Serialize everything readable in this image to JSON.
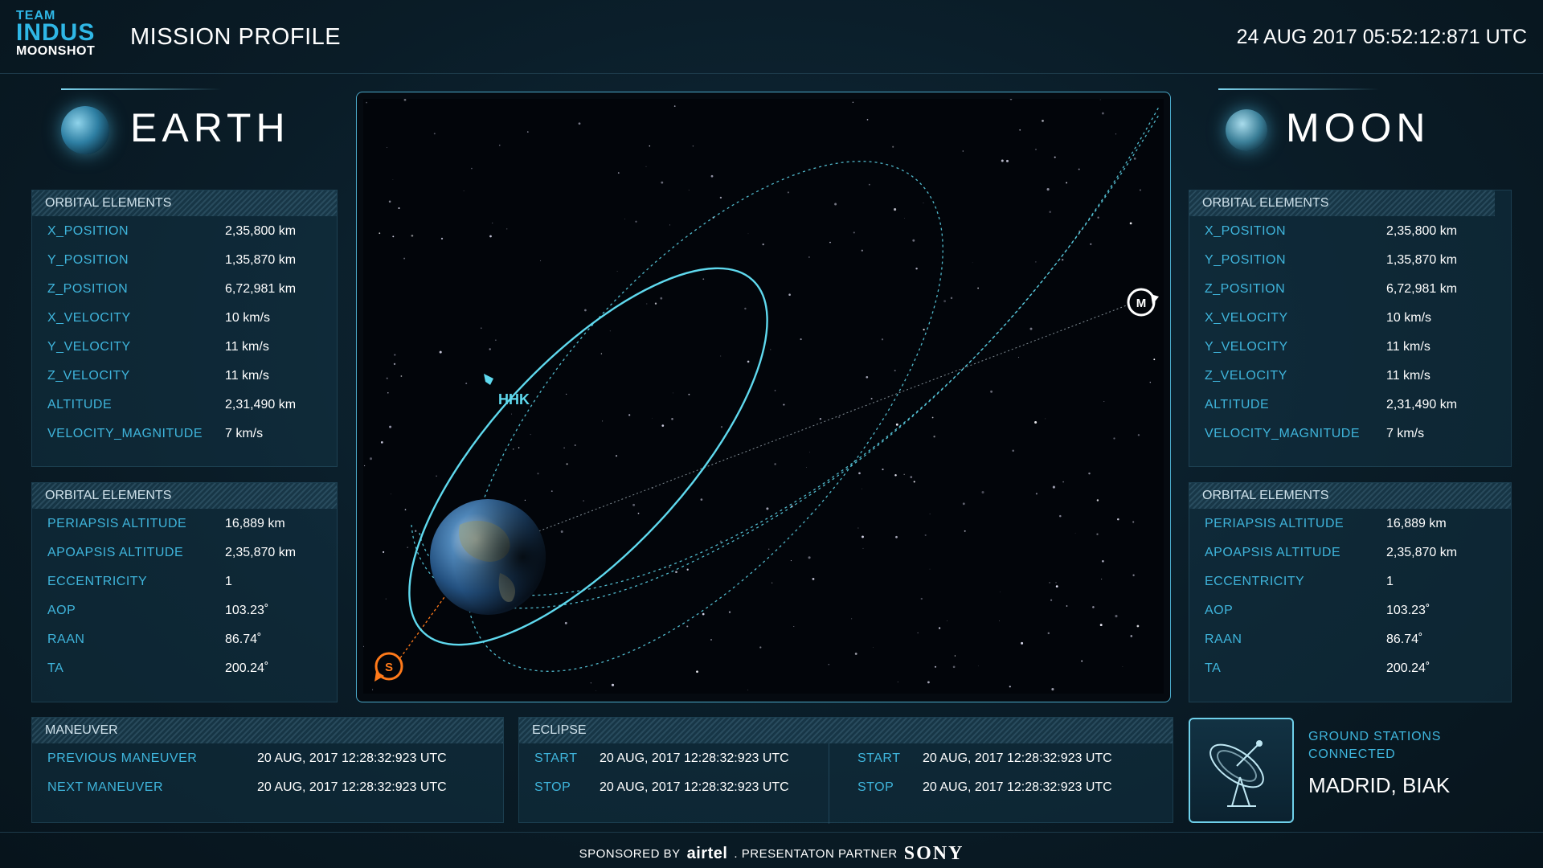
{
  "header": {
    "logo": {
      "line1": "TEAM",
      "line2": "INDUS",
      "line3": "MOONSHOT"
    },
    "title": "MISSION PROFILE",
    "timestamp": "24 AUG 2017 05:52:12:871 UTC"
  },
  "earth": {
    "name": "EARTH",
    "orbital_elements_1": {
      "title": "ORBITAL ELEMENTS",
      "rows": [
        {
          "label": "X_POSITION",
          "value": "2,35,800 km"
        },
        {
          "label": "Y_POSITION",
          "value": "1,35,870 km"
        },
        {
          "label": "Z_POSITION",
          "value": "6,72,981 km"
        },
        {
          "label": "X_VELOCITY",
          "value": "10 km/s"
        },
        {
          "label": "Y_VELOCITY",
          "value": "11 km/s"
        },
        {
          "label": "Z_VELOCITY",
          "value": "11 km/s"
        },
        {
          "label": "ALTITUDE",
          "value": "2,31,490 km"
        },
        {
          "label": "VELOCITY_MAGNITUDE",
          "value": "7 km/s"
        }
      ]
    },
    "orbital_elements_2": {
      "title": "ORBITAL ELEMENTS",
      "rows": [
        {
          "label": "PERIAPSIS ALTITUDE",
          "value": "16,889 km"
        },
        {
          "label": "APOAPSIS ALTITUDE",
          "value": "2,35,870 km"
        },
        {
          "label": "ECCENTRICITY",
          "value": "1"
        },
        {
          "label": "AOP",
          "value": "103.23˚"
        },
        {
          "label": "RAAN",
          "value": "86.74˚"
        },
        {
          "label": "TA",
          "value": "200.24˚"
        }
      ]
    }
  },
  "moon": {
    "name": "MOON",
    "orbital_elements_1": {
      "title": "ORBITAL ELEMENTS",
      "rows": [
        {
          "label": "X_POSITION",
          "value": "2,35,800 km"
        },
        {
          "label": "Y_POSITION",
          "value": "1,35,870 km"
        },
        {
          "label": "Z_POSITION",
          "value": "6,72,981 km"
        },
        {
          "label": "X_VELOCITY",
          "value": "10 km/s"
        },
        {
          "label": "Y_VELOCITY",
          "value": "11 km/s"
        },
        {
          "label": "Z_VELOCITY",
          "value": "11 km/s"
        },
        {
          "label": "ALTITUDE",
          "value": "2,31,490 km"
        },
        {
          "label": "VELOCITY_MAGNITUDE",
          "value": "7 km/s"
        }
      ]
    },
    "orbital_elements_2": {
      "title": "ORBITAL ELEMENTS",
      "rows": [
        {
          "label": "PERIAPSIS ALTITUDE",
          "value": "16,889 km"
        },
        {
          "label": "APOAPSIS ALTITUDE",
          "value": "2,35,870 km"
        },
        {
          "label": "ECCENTRICITY",
          "value": "1"
        },
        {
          "label": "AOP",
          "value": "103.23˚"
        },
        {
          "label": "RAAN",
          "value": "86.74˚"
        },
        {
          "label": "TA",
          "value": "200.24˚"
        }
      ]
    }
  },
  "map": {
    "spacecraft_label": "HHK",
    "moon_marker": "M",
    "sun_marker": "S",
    "colors": {
      "orbit": "#5fd9ee",
      "sun": "#ff7a1a",
      "moon": "#ffffff"
    }
  },
  "maneuver": {
    "title": "MANEUVER",
    "rows": [
      {
        "label": "PREVIOUS MANEUVER",
        "value": "20 AUG, 2017 12:28:32:923 UTC"
      },
      {
        "label": "NEXT MANEUVER",
        "value": "20 AUG, 2017 12:28:32:923 UTC"
      }
    ]
  },
  "eclipse": {
    "title": "ECLIPSE",
    "left": [
      {
        "label": "START",
        "value": "20 AUG, 2017 12:28:32:923 UTC"
      },
      {
        "label": "STOP",
        "value": "20 AUG, 2017 12:28:32:923 UTC"
      }
    ],
    "right": [
      {
        "label": "START",
        "value": "20 AUG, 2017 12:28:32:923 UTC"
      },
      {
        "label": "STOP",
        "value": "20 AUG, 2017 12:28:32:923 UTC"
      }
    ]
  },
  "ground_stations": {
    "label_line1": "GROUND STATIONS",
    "label_line2": "CONNECTED",
    "value": "MADRID, BIAK",
    "icon": "satellite-dish-icon"
  },
  "footer": {
    "sponsored_by": "SPONSORED BY",
    "sponsor": "airtel",
    "partner_text": ". PRESENTATON PARTNER",
    "partner": "SONY"
  }
}
